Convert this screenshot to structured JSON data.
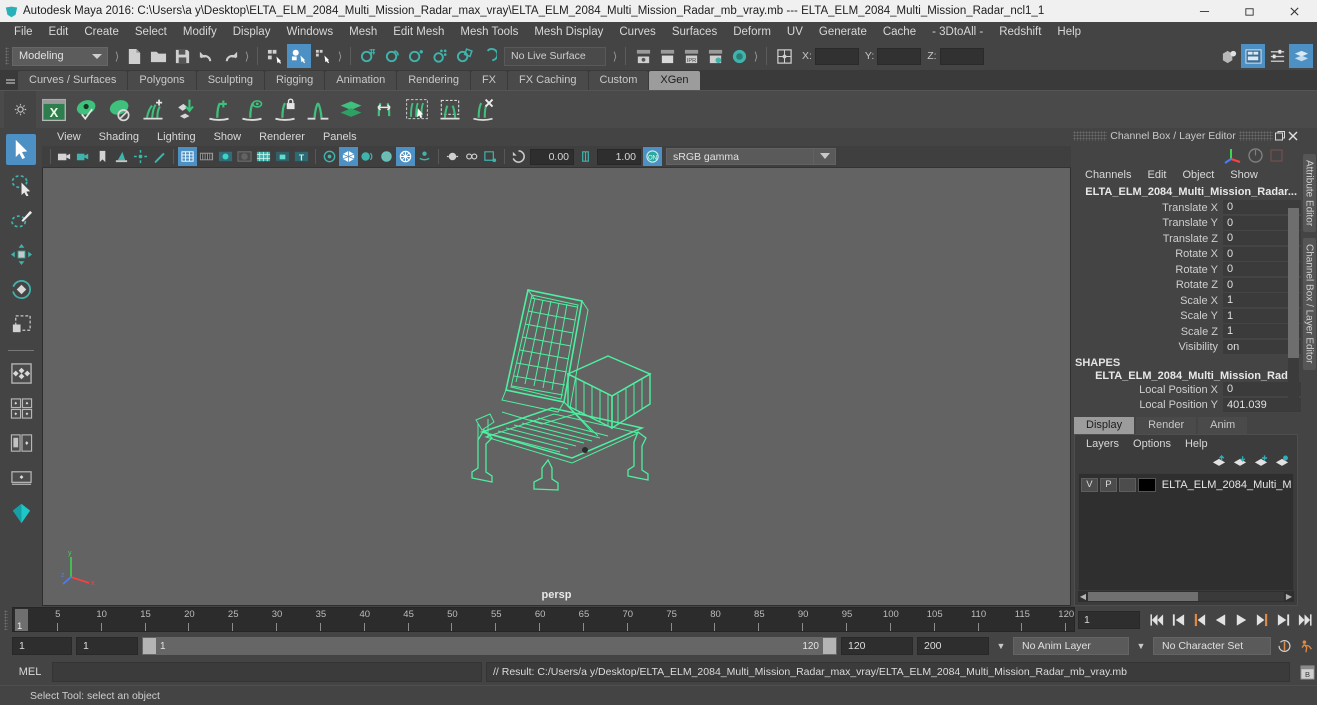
{
  "titlebar": {
    "title": "Autodesk Maya 2016: C:\\Users\\a y\\Desktop\\ELTA_ELM_2084_Multi_Mission_Radar_max_vray\\ELTA_ELM_2084_Multi_Mission_Radar_mb_vray.mb  ---  ELTA_ELM_2084_Multi_Mission_Radar_ncl1_1",
    "minimize": "minimize-icon",
    "restore": "restore-icon",
    "close": "close-icon"
  },
  "menubar": {
    "items": [
      "File",
      "Edit",
      "Create",
      "Select",
      "Modify",
      "Display",
      "Windows",
      "Mesh",
      "Edit Mesh",
      "Mesh Tools",
      "Mesh Display",
      "Curves",
      "Surfaces",
      "Deform",
      "UV",
      "Generate",
      "Cache",
      "- 3DtoAll -",
      "Redshift",
      "Help"
    ]
  },
  "statusline": {
    "mode": "Modeling",
    "live_surface": "No Live Surface",
    "coord_x_label": "X:",
    "coord_y_label": "Y:",
    "coord_z_label": "Z:",
    "coord_x_value": "",
    "coord_y_value": "",
    "coord_z_value": ""
  },
  "shelf": {
    "tabs": [
      "Curves / Surfaces",
      "Polygons",
      "Sculpting",
      "Rigging",
      "Animation",
      "Rendering",
      "FX",
      "FX Caching",
      "Custom",
      "XGen"
    ],
    "active_tab": "XGen",
    "icons": [
      "xgen-window-icon",
      "xgen-preview-icon",
      "xgen-disable-preview-icon",
      "xgen-add-guides-icon",
      "xgen-place-guide-icon",
      "xgen-add-grooming-icon",
      "xgen-show-guide-icon",
      "xgen-lock-guide-icon",
      "xgen-mirror-guide-icon",
      "xgen-layers-icon",
      "xgen-sculpt-icon",
      "xgen-select-guide-icon",
      "xgen-region-icon",
      "xgen-delete-guide-icon"
    ]
  },
  "toolbox": {
    "tools": [
      "select-tool",
      "lasso-select-tool",
      "paint-select-tool",
      "move-tool",
      "rotate-tool",
      "scale-tool",
      "last-tool",
      "quad-layout-four-view",
      "layout-two-panes",
      "layout-persp-outliner",
      "layout-single-persp",
      "layout-hypershade"
    ]
  },
  "viewport": {
    "menus": [
      "View",
      "Shading",
      "Lighting",
      "Show",
      "Renderer",
      "Panels"
    ],
    "exposure": "0.00",
    "gamma_value": "1.00",
    "color_profile": "sRGB gamma",
    "camera_label": "persp"
  },
  "channelbox": {
    "panel_title": "Channel Box / Layer Editor",
    "menus": [
      "Channels",
      "Edit",
      "Object",
      "Show"
    ],
    "object_name": "ELTA_ELM_2084_Multi_Mission_Radar...",
    "channels": [
      {
        "label": "Translate X",
        "value": "0"
      },
      {
        "label": "Translate Y",
        "value": "0"
      },
      {
        "label": "Translate Z",
        "value": "0"
      },
      {
        "label": "Rotate X",
        "value": "0"
      },
      {
        "label": "Rotate Y",
        "value": "0"
      },
      {
        "label": "Rotate Z",
        "value": "0"
      },
      {
        "label": "Scale X",
        "value": "1"
      },
      {
        "label": "Scale Y",
        "value": "1"
      },
      {
        "label": "Scale Z",
        "value": "1"
      },
      {
        "label": "Visibility",
        "value": "on"
      }
    ],
    "shapes_header": "SHAPES",
    "shape_name": "ELTA_ELM_2084_Multi_Mission_Rad...",
    "shape_channels": [
      {
        "label": "Local Position X",
        "value": "0"
      },
      {
        "label": "Local Position Y",
        "value": "401.039"
      }
    ]
  },
  "layereditor": {
    "tabs": [
      "Display",
      "Render",
      "Anim"
    ],
    "active_tab": "Display",
    "menus": [
      "Layers",
      "Options",
      "Help"
    ],
    "buttons": [
      "layer-move-up-icon",
      "layer-move-down-icon",
      "layer-new-icon",
      "layer-new-from-selected-icon"
    ],
    "layers": [
      {
        "visibility": "V",
        "playback": "P",
        "shading": "",
        "color": "#000000",
        "name": "ELTA_ELM_2084_Multi_M"
      }
    ]
  },
  "vtabs": [
    "Attribute Editor",
    "Channel Box / Layer Editor"
  ],
  "timeslider": {
    "ticks": [
      5,
      10,
      15,
      20,
      25,
      30,
      35,
      40,
      45,
      50,
      55,
      60,
      65,
      70,
      75,
      80,
      85,
      90,
      95,
      100,
      105,
      110,
      115,
      120
    ],
    "current_frame": "1",
    "frame_field": "1",
    "transport": [
      "go-to-start-icon",
      "step-back-keyframe-icon",
      "step-back-frame-icon",
      "play-backwards-icon",
      "play-forwards-icon",
      "step-forward-frame-icon",
      "step-forward-keyframe-icon",
      "go-to-end-icon"
    ]
  },
  "rangeslider": {
    "anim_start": "1",
    "range_start": "1",
    "bar_start": "1",
    "bar_end": "120",
    "range_end": "120",
    "anim_end": "200",
    "anim_layer": "No Anim Layer",
    "character_set": "No Character Set",
    "auto_key": "auto-keyframe-icon",
    "anim_prefs": "animation-preferences-icon"
  },
  "commandline": {
    "label": "MEL",
    "input_value": "",
    "result": "// Result: C:/Users/a y/Desktop/ELTA_ELM_2084_Multi_Mission_Radar_max_vray/ELTA_ELM_2084_Multi_Mission_Radar_mb_vray.mb",
    "script_editor_button": "script-editor-icon"
  },
  "helpline": {
    "text": "Select Tool: select an object"
  },
  "colors": {
    "accent_blue": "#4d90c4",
    "teal": "#39b0a8",
    "wireframe_green": "#4df0a0",
    "viewport_bg": "#636363",
    "ui_bg": "#444444"
  }
}
